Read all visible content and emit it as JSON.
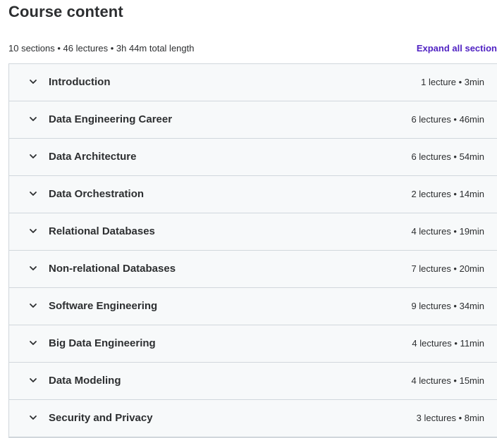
{
  "header": {
    "title": "Course content",
    "summary": "10 sections • 46 lectures • 3h 44m total length",
    "expand_label": "Expand all section"
  },
  "colors": {
    "accent": "#5022c3",
    "row_background": "#f7f9fa",
    "border": "#d1d7dc",
    "text": "#2d2f31"
  },
  "sections": [
    {
      "title": "Introduction",
      "meta": "1 lecture • 3min",
      "icon": "chevron-down-icon"
    },
    {
      "title": "Data Engineering Career",
      "meta": "6 lectures • 46min",
      "icon": "chevron-down-icon"
    },
    {
      "title": "Data Architecture",
      "meta": "6 lectures • 54min",
      "icon": "chevron-down-icon"
    },
    {
      "title": "Data Orchestration",
      "meta": "2 lectures • 14min",
      "icon": "chevron-down-icon"
    },
    {
      "title": "Relational Databases",
      "meta": "4 lectures • 19min",
      "icon": "chevron-down-icon"
    },
    {
      "title": "Non-relational Databases",
      "meta": "7 lectures • 20min",
      "icon": "chevron-down-icon"
    },
    {
      "title": "Software Engineering",
      "meta": "9 lectures • 34min",
      "icon": "chevron-down-icon"
    },
    {
      "title": "Big Data Engineering",
      "meta": "4 lectures • 11min",
      "icon": "chevron-down-icon"
    },
    {
      "title": "Data Modeling",
      "meta": "4 lectures • 15min",
      "icon": "chevron-down-icon"
    },
    {
      "title": "Security and Privacy",
      "meta": "3 lectures • 8min",
      "icon": "chevron-down-icon"
    }
  ]
}
